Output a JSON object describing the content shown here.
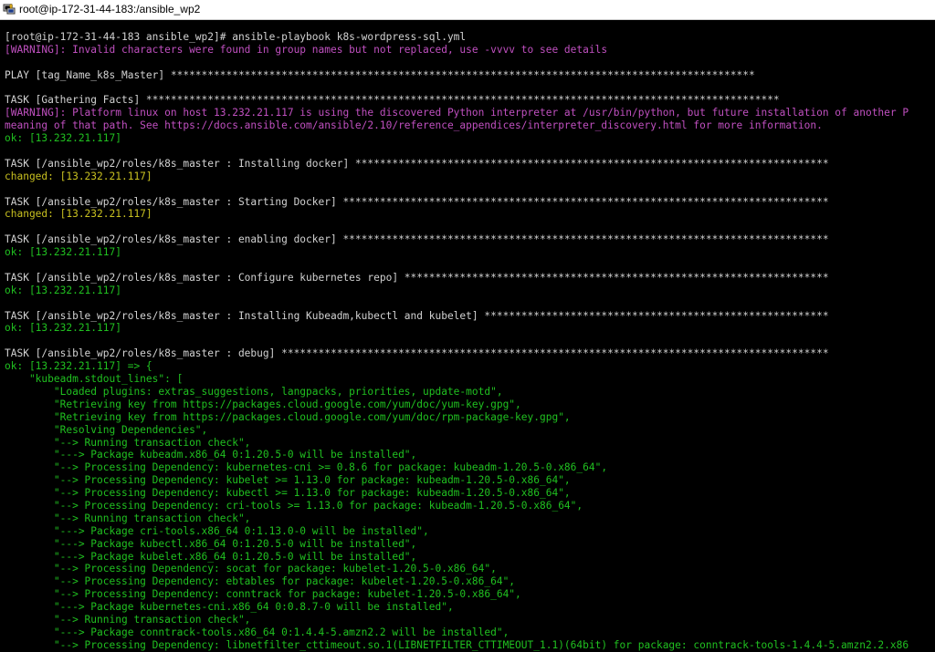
{
  "window": {
    "title": "root@ip-172-31-44-183:/ansible_wp2",
    "icon": "putty-terminal-icon"
  },
  "colors": {
    "white": "#d2d2d2",
    "magenta": "#c050c0",
    "green": "#20c020",
    "yellow": "#c8c020",
    "background": "#000000"
  },
  "terminal": {
    "lines": [
      [
        {
          "t": "[root@ip-172-31-44-183 ansible_wp2]# ansible-playbook k8s-wordpress-sql.yml",
          "c": "white"
        }
      ],
      [
        {
          "t": "[WARNING]: Invalid characters were found in group names but not replaced, use -vvvv to see details",
          "c": "magenta"
        }
      ],
      [],
      [
        {
          "t": "PLAY [tag_Name_k8s_Master] ***********************************************************************************************",
          "c": "white"
        }
      ],
      [],
      [
        {
          "t": "TASK [Gathering Facts] *******************************************************************************************************",
          "c": "white"
        }
      ],
      [
        {
          "t": "[WARNING]: Platform linux on host 13.232.21.117 is using the discovered Python interpreter at /usr/bin/python, but future installation of another P",
          "c": "magenta"
        }
      ],
      [
        {
          "t": "meaning of that path. See https://docs.ansible.com/ansible/2.10/reference_appendices/interpreter_discovery.html for more information.",
          "c": "magenta"
        }
      ],
      [
        {
          "t": "ok: [13.232.21.117]",
          "c": "green"
        }
      ],
      [],
      [
        {
          "t": "TASK [/ansible_wp2/roles/k8s_master : Installing docker] *****************************************************************************",
          "c": "white"
        }
      ],
      [
        {
          "t": "changed: [13.232.21.117]",
          "c": "yellow"
        }
      ],
      [],
      [
        {
          "t": "TASK [/ansible_wp2/roles/k8s_master : Starting Docker] *******************************************************************************",
          "c": "white"
        }
      ],
      [
        {
          "t": "changed: [13.232.21.117]",
          "c": "yellow"
        }
      ],
      [],
      [
        {
          "t": "TASK [/ansible_wp2/roles/k8s_master : enabling docker] *******************************************************************************",
          "c": "white"
        }
      ],
      [
        {
          "t": "ok: [13.232.21.117]",
          "c": "green"
        }
      ],
      [],
      [
        {
          "t": "TASK [/ansible_wp2/roles/k8s_master : Configure kubernetes repo] *********************************************************************",
          "c": "white"
        }
      ],
      [
        {
          "t": "ok: [13.232.21.117]",
          "c": "green"
        }
      ],
      [],
      [
        {
          "t": "TASK [/ansible_wp2/roles/k8s_master : Installing Kubeadm,kubectl and kubelet] ********************************************************",
          "c": "white"
        }
      ],
      [
        {
          "t": "ok: [13.232.21.117]",
          "c": "green"
        }
      ],
      [],
      [
        {
          "t": "TASK [/ansible_wp2/roles/k8s_master : debug] *****************************************************************************************",
          "c": "white"
        }
      ],
      [
        {
          "t": "ok: [13.232.21.117] => {",
          "c": "green"
        }
      ],
      [
        {
          "t": "    \"kubeadm.stdout_lines\": [",
          "c": "green"
        }
      ],
      [
        {
          "t": "        \"Loaded plugins: extras_suggestions, langpacks, priorities, update-motd\",",
          "c": "green"
        }
      ],
      [
        {
          "t": "        \"Retrieving key from https://packages.cloud.google.com/yum/doc/yum-key.gpg\",",
          "c": "green"
        }
      ],
      [
        {
          "t": "        \"Retrieving key from https://packages.cloud.google.com/yum/doc/rpm-package-key.gpg\",",
          "c": "green"
        }
      ],
      [
        {
          "t": "        \"Resolving Dependencies\",",
          "c": "green"
        }
      ],
      [
        {
          "t": "        \"--> Running transaction check\",",
          "c": "green"
        }
      ],
      [
        {
          "t": "        \"---> Package kubeadm.x86_64 0:1.20.5-0 will be installed\",",
          "c": "green"
        }
      ],
      [
        {
          "t": "        \"--> Processing Dependency: kubernetes-cni >= 0.8.6 for package: kubeadm-1.20.5-0.x86_64\",",
          "c": "green"
        }
      ],
      [
        {
          "t": "        \"--> Processing Dependency: kubelet >= 1.13.0 for package: kubeadm-1.20.5-0.x86_64\",",
          "c": "green"
        }
      ],
      [
        {
          "t": "        \"--> Processing Dependency: kubectl >= 1.13.0 for package: kubeadm-1.20.5-0.x86_64\",",
          "c": "green"
        }
      ],
      [
        {
          "t": "        \"--> Processing Dependency: cri-tools >= 1.13.0 for package: kubeadm-1.20.5-0.x86_64\",",
          "c": "green"
        }
      ],
      [
        {
          "t": "        \"--> Running transaction check\",",
          "c": "green"
        }
      ],
      [
        {
          "t": "        \"---> Package cri-tools.x86_64 0:1.13.0-0 will be installed\",",
          "c": "green"
        }
      ],
      [
        {
          "t": "        \"---> Package kubectl.x86_64 0:1.20.5-0 will be installed\",",
          "c": "green"
        }
      ],
      [
        {
          "t": "        \"---> Package kubelet.x86_64 0:1.20.5-0 will be installed\",",
          "c": "green"
        }
      ],
      [
        {
          "t": "        \"--> Processing Dependency: socat for package: kubelet-1.20.5-0.x86_64\",",
          "c": "green"
        }
      ],
      [
        {
          "t": "        \"--> Processing Dependency: ebtables for package: kubelet-1.20.5-0.x86_64\",",
          "c": "green"
        }
      ],
      [
        {
          "t": "        \"--> Processing Dependency: conntrack for package: kubelet-1.20.5-0.x86_64\",",
          "c": "green"
        }
      ],
      [
        {
          "t": "        \"---> Package kubernetes-cni.x86_64 0:0.8.7-0 will be installed\",",
          "c": "green"
        }
      ],
      [
        {
          "t": "        \"--> Running transaction check\",",
          "c": "green"
        }
      ],
      [
        {
          "t": "        \"---> Package conntrack-tools.x86_64 0:1.4.4-5.amzn2.2 will be installed\",",
          "c": "green"
        }
      ],
      [
        {
          "t": "        \"--> Processing Dependency: libnetfilter_cttimeout.so.1(LIBNETFILTER_CTTIMEOUT_1.1)(64bit) for package: conntrack-tools-1.4.4-5.amzn2.2.x86",
          "c": "green"
        }
      ]
    ]
  }
}
